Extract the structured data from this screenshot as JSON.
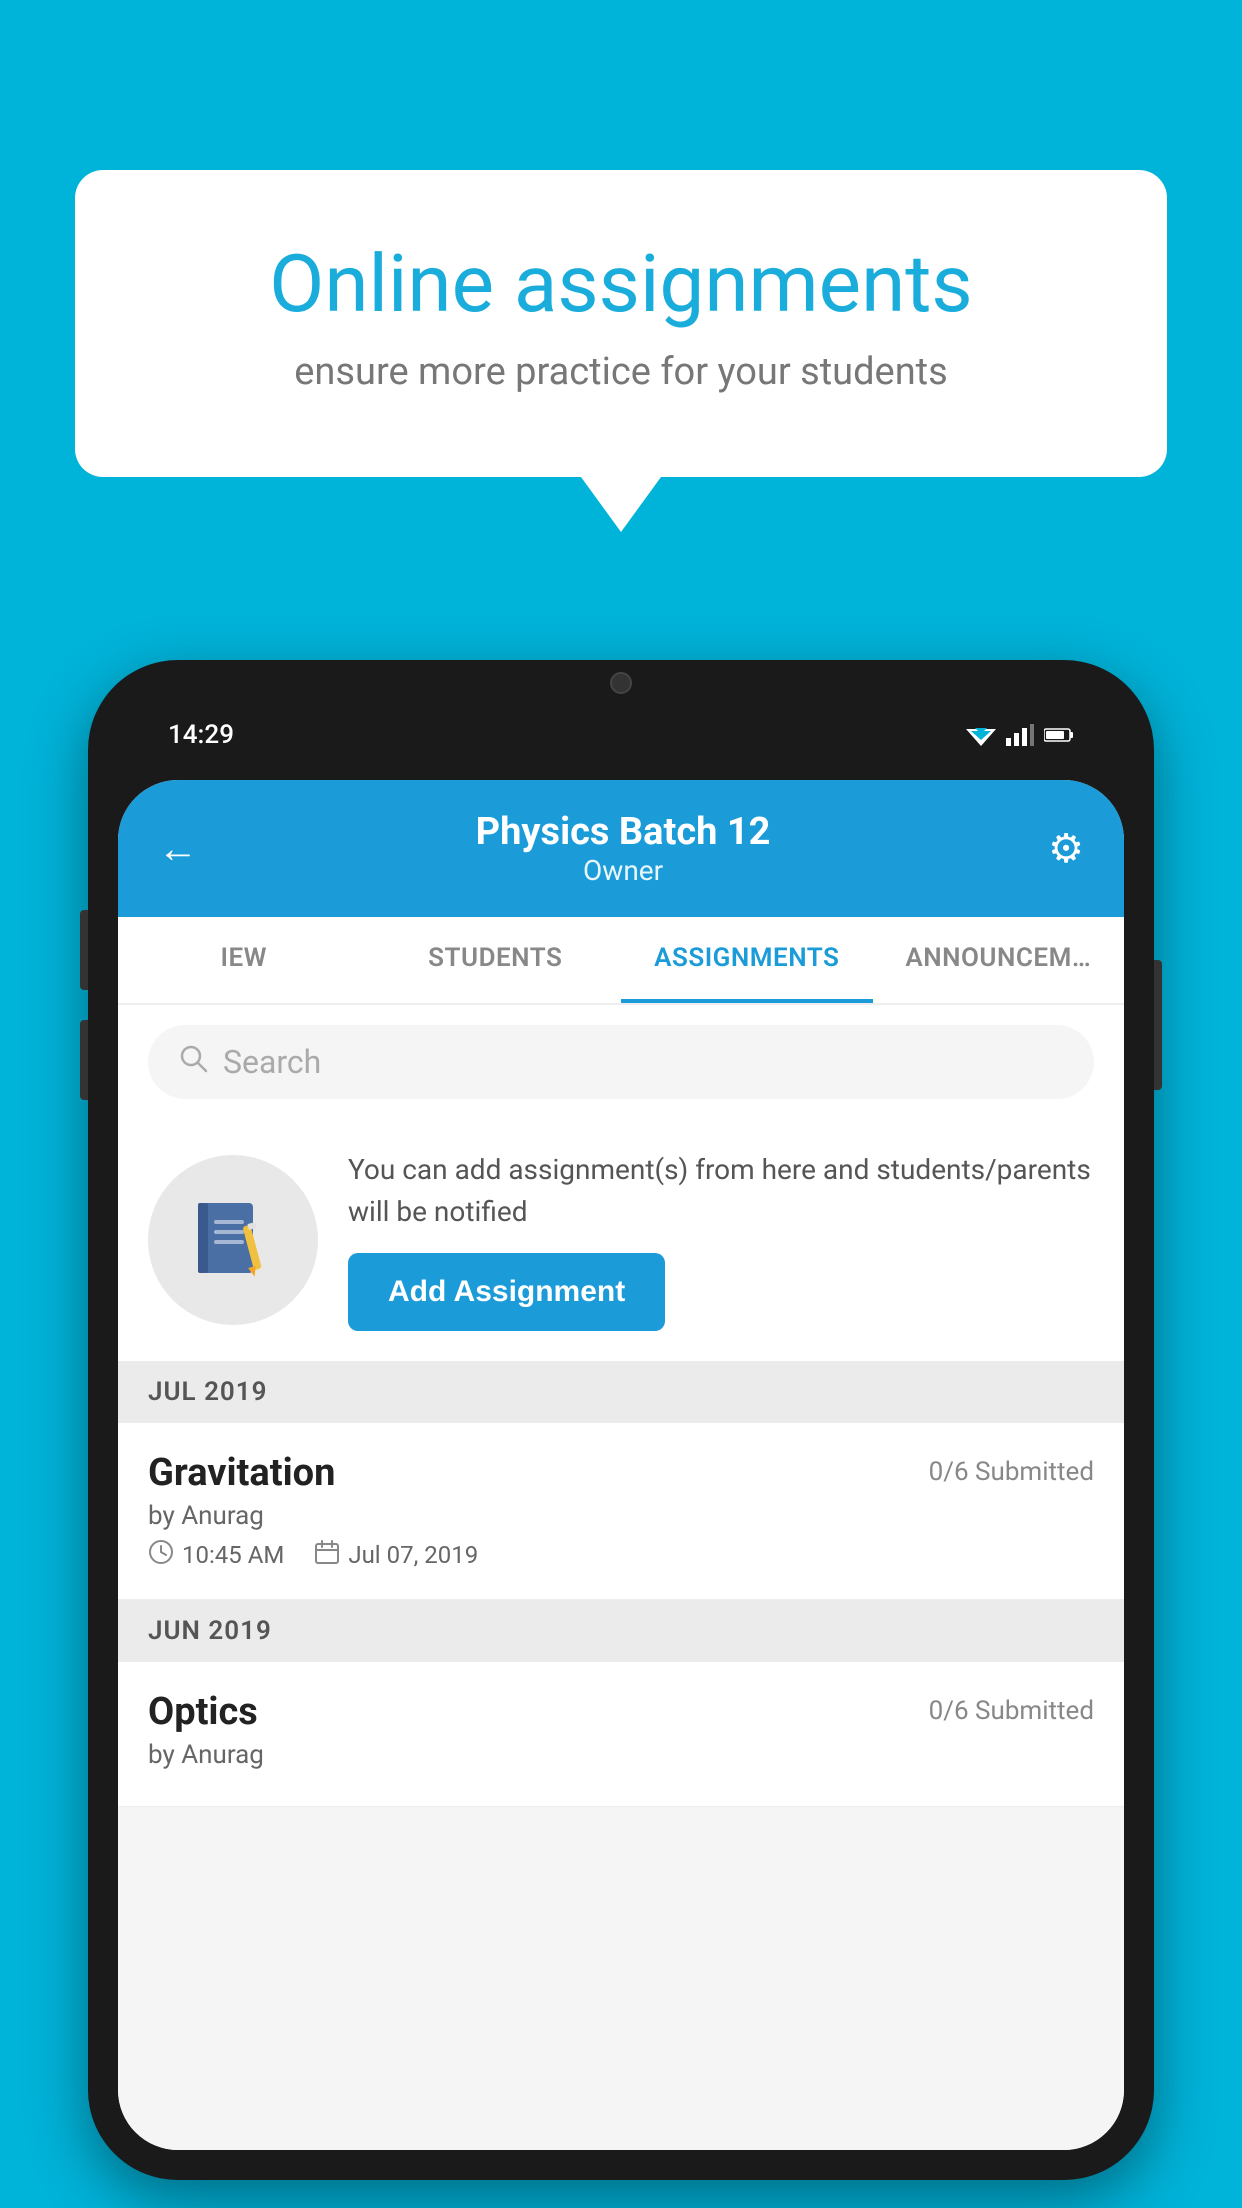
{
  "background_color": "#00B3D9",
  "speech_bubble": {
    "title": "Online assignments",
    "subtitle": "ensure more practice for your students"
  },
  "phone": {
    "status_bar": {
      "time": "14:29"
    },
    "header": {
      "title": "Physics Batch 12",
      "subtitle": "Owner",
      "back_label": "←",
      "gear_label": "⚙"
    },
    "tabs": [
      {
        "label": "IEW",
        "active": false
      },
      {
        "label": "STUDENTS",
        "active": false
      },
      {
        "label": "ASSIGNMENTS",
        "active": true
      },
      {
        "label": "ANNOUNCEM…",
        "active": false
      }
    ],
    "search": {
      "placeholder": "Search"
    },
    "info_card": {
      "description": "You can add assignment(s) from here and students/parents will be notified",
      "button_label": "Add Assignment"
    },
    "sections": [
      {
        "month_label": "JUL 2019",
        "assignments": [
          {
            "title": "Gravitation",
            "submitted": "0/6 Submitted",
            "author": "by Anurag",
            "time": "10:45 AM",
            "date": "Jul 07, 2019"
          }
        ]
      },
      {
        "month_label": "JUN 2019",
        "assignments": [
          {
            "title": "Optics",
            "submitted": "0/6 Submitted",
            "author": "by Anurag",
            "time": "",
            "date": ""
          }
        ]
      }
    ]
  }
}
